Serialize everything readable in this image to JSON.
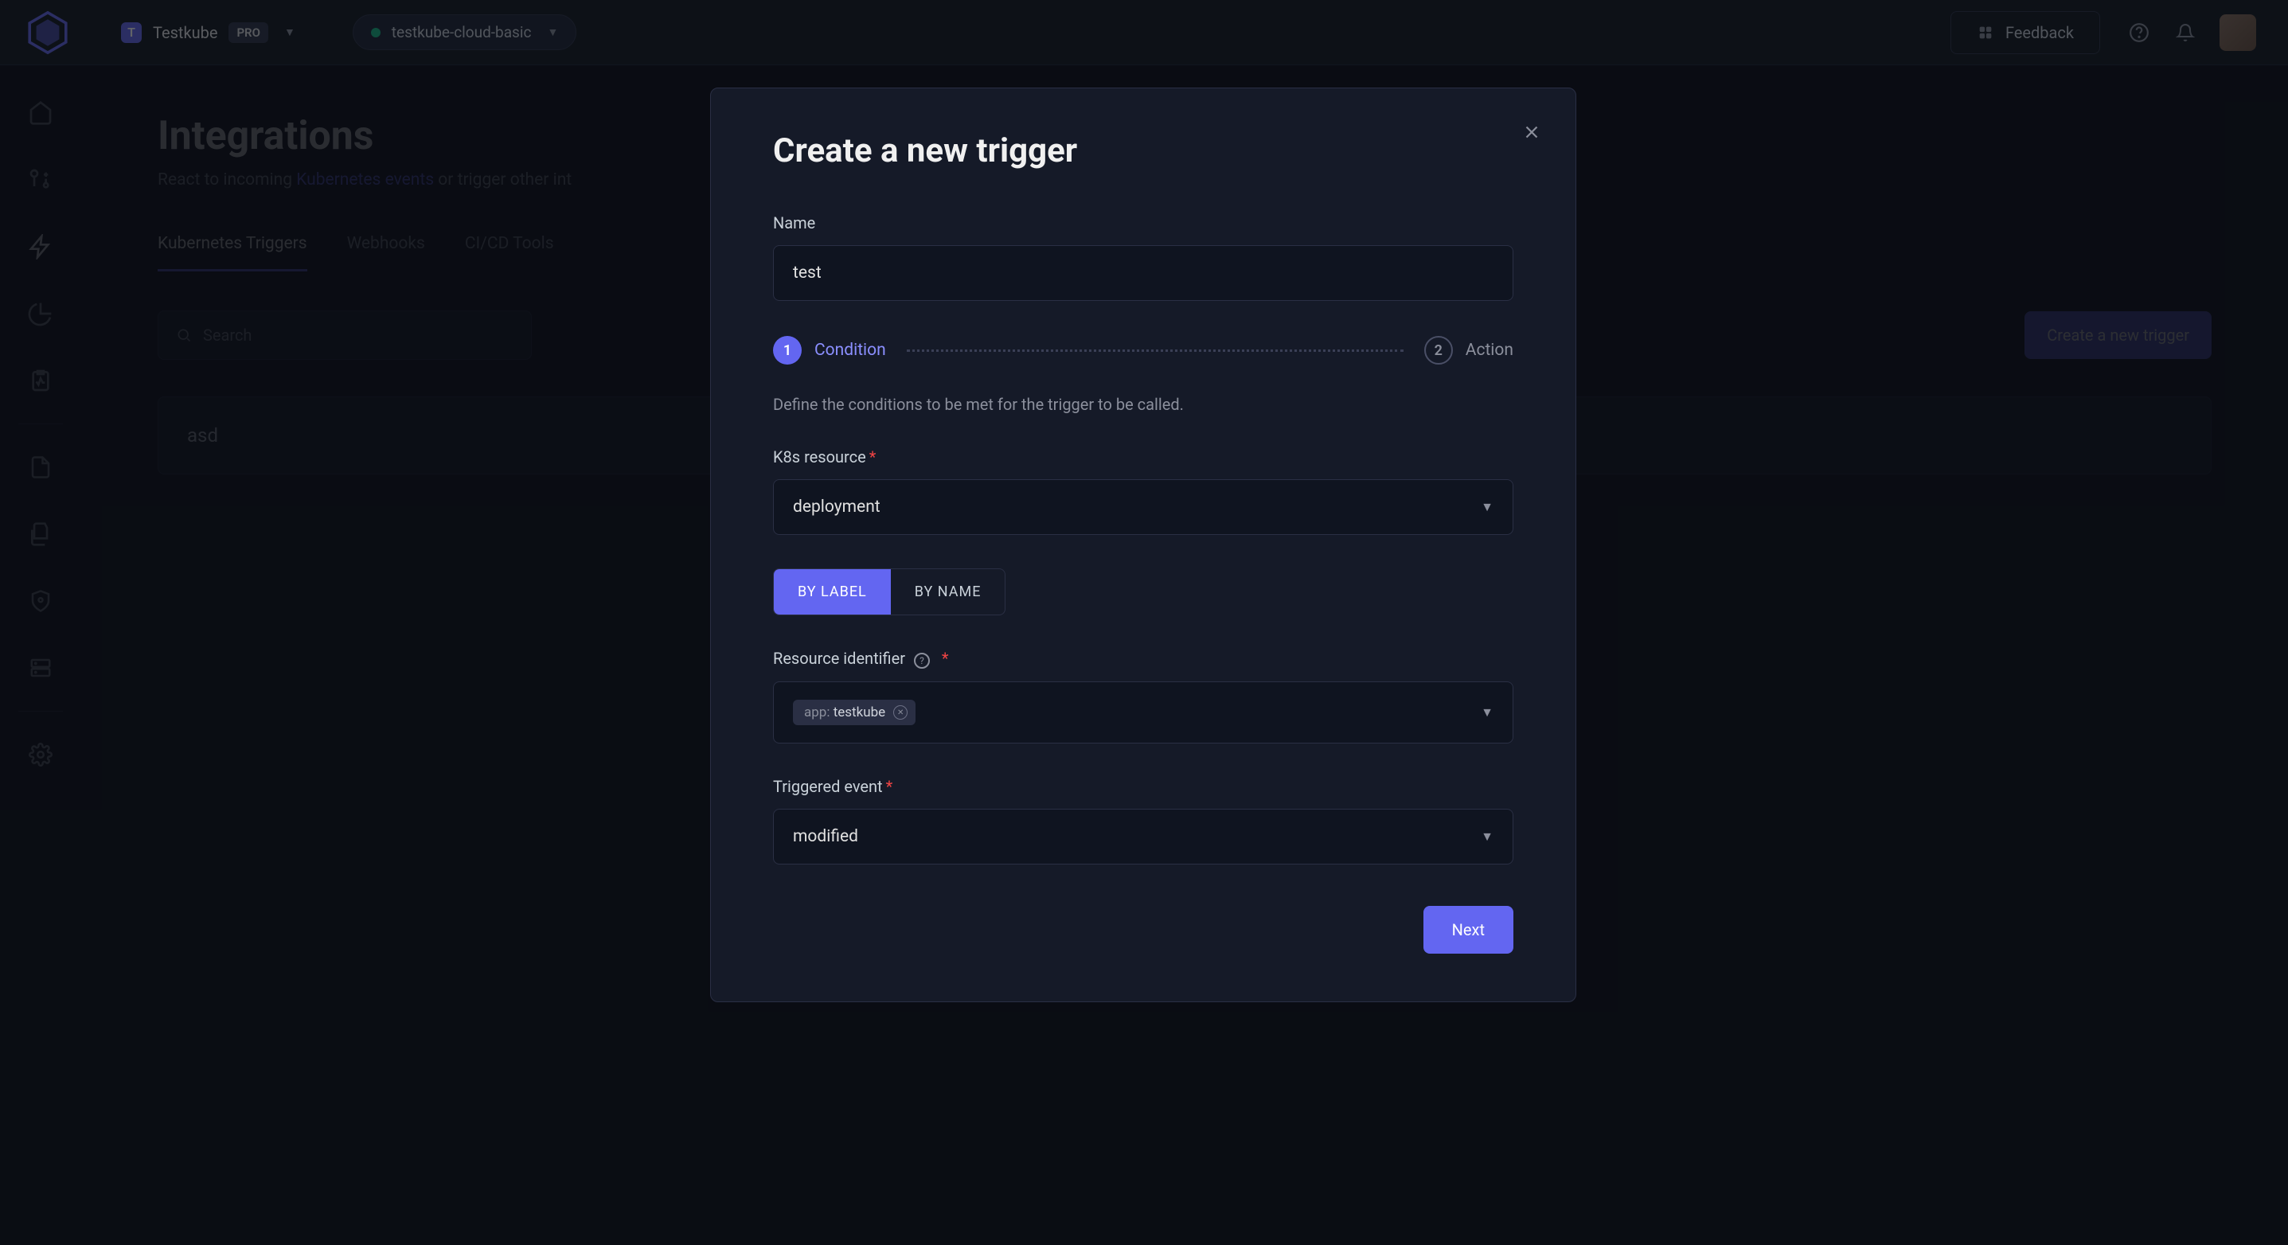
{
  "topbar": {
    "org_initial": "T",
    "org_name": "Testkube",
    "pro_label": "PRO",
    "env_name": "testkube-cloud-basic",
    "feedback_label": "Feedback"
  },
  "page": {
    "title": "Integrations",
    "subtitle_prefix": "React to incoming ",
    "subtitle_link": "Kubernetes events",
    "subtitle_suffix": " or trigger other int"
  },
  "tabs": {
    "triggers": "Kubernetes Triggers",
    "webhooks": "Webhooks",
    "cicd": "CI/CD Tools"
  },
  "toolbar": {
    "search_placeholder": "Search",
    "create_label": "Create a new trigger"
  },
  "list": {
    "items": [
      "asd"
    ]
  },
  "modal": {
    "title": "Create a new trigger",
    "name_label": "Name",
    "name_value": "test",
    "step1_num": "1",
    "step1_label": "Condition",
    "step2_num": "2",
    "step2_label": "Action",
    "condition_help": "Define the conditions to be met for the trigger to be called.",
    "k8s_label": "K8s resource",
    "k8s_value": "deployment",
    "by_label": "BY LABEL",
    "by_name": "BY NAME",
    "resource_id_label": "Resource identifier",
    "tag_key": "app:",
    "tag_value": "testkube",
    "event_label": "Triggered event",
    "event_value": "modified",
    "next_label": "Next"
  }
}
